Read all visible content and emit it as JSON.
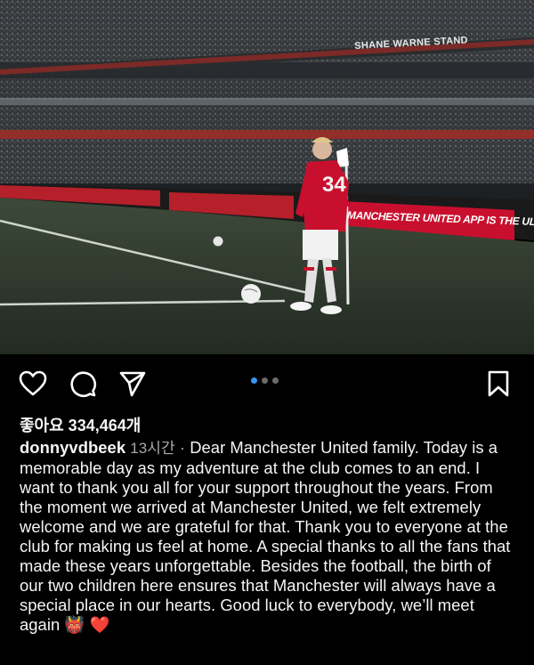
{
  "photo": {
    "stand_sign": "SHANE WARNE STAND",
    "banner": "MANCHESTER UNITED APP IS THE ULTIMATE FAN EXPERIENCE",
    "jersey_number": "34",
    "carousel_total": 3,
    "carousel_active": 1
  },
  "actions": {
    "like_icon": "heart-icon",
    "comment_icon": "comment-icon",
    "share_icon": "send-icon",
    "save_icon": "bookmark-icon"
  },
  "post": {
    "likes": "좋아요 334,464개",
    "username": "donnyvdbeek",
    "time": "13시간",
    "separator": "·",
    "caption": "Dear Manchester United family. Today is a memorable day as my adventure at the club comes to an end. I want to thank you all for your support throughout the years. From the moment we arrived at Manchester United, we felt extremely welcome and we are grateful for that. Thank you to everyone at the club for making us feel at home. A special thanks to all the fans that made these years unforgettable. Besides the football, the birth of our two children here ensures that Manchester will always have a special place in our hearts. Good luck to everybody, we’ll meet again",
    "emojis": "👹 ❤️"
  },
  "colors": {
    "background": "#000000",
    "accent_dot": "#3a96f0",
    "muted_text": "#a8a8a8",
    "united_red": "#c8102e"
  }
}
